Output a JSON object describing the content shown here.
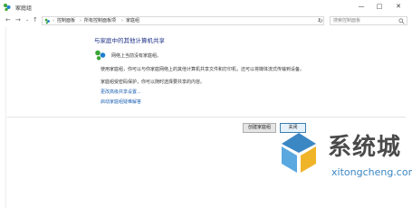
{
  "window": {
    "title": "家庭组",
    "controls": {
      "minimize": "—",
      "maximize": "□",
      "close": "✕"
    }
  },
  "nav": {
    "back": "←",
    "forward": "→",
    "history": "⌄",
    "up": "↑",
    "breadcrumbs": [
      "控制面板",
      "所有控制面板项",
      "家庭组"
    ],
    "refresh": "↻",
    "search_placeholder": "搜索控制面板"
  },
  "content": {
    "heading": "与家庭中的其他计算机共享",
    "status": "网络上当前没有家庭组。",
    "para1": "使用家庭组，你可以与你家庭网络上的其他计算机共享文件和打印机，还可以将媒体流式传输到设备。",
    "para2": "家庭组受密码保护，你可以随时选择要共享的内容。",
    "links": [
      "更改高级共享设置...",
      "启动家庭组疑难解答"
    ]
  },
  "buttons": {
    "create": "创建家庭组",
    "close": "关闭"
  },
  "watermark": {
    "text_cn": "系统城",
    "text_en": "xitongcheng.com"
  },
  "colors": {
    "heading": "#1e3287",
    "link": "#1a5fb4",
    "homegroup_green": "#3aa537",
    "homegroup_blue": "#1e7fd1",
    "watermark_blue": "#3b87c4"
  }
}
